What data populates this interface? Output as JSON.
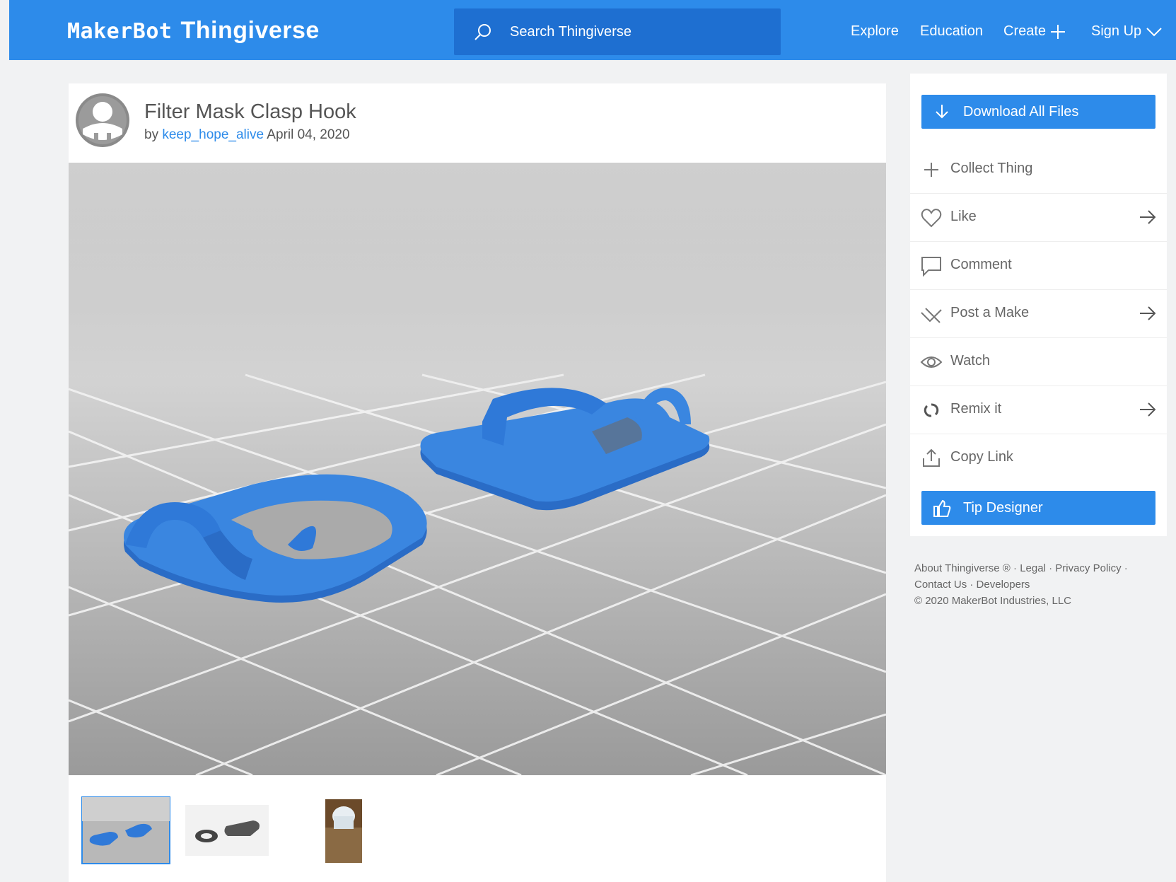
{
  "brand": {
    "logo_mark": "MakerBot",
    "logo_name": "Thingiverse"
  },
  "search": {
    "placeholder": "Search Thingiverse"
  },
  "nav": {
    "explore": "Explore",
    "education": "Education",
    "create": "Create",
    "signup": "Sign Up"
  },
  "thing": {
    "title": "Filter Mask Clasp Hook",
    "by": "by",
    "author": "keep_hope_alive",
    "date": "April 04, 2020"
  },
  "sidebar": {
    "download": "Download All Files",
    "actions": [
      {
        "label": "Collect Thing",
        "icon": "plus-icon",
        "arrow": false
      },
      {
        "label": "Like",
        "icon": "heart-icon",
        "arrow": true
      },
      {
        "label": "Comment",
        "icon": "comment-icon",
        "arrow": false
      },
      {
        "label": "Post a Make",
        "icon": "pencil-icon",
        "arrow": true
      },
      {
        "label": "Watch",
        "icon": "eye-icon",
        "arrow": false
      },
      {
        "label": "Remix it",
        "icon": "remix-icon",
        "arrow": true
      },
      {
        "label": "Copy Link",
        "icon": "share-icon",
        "arrow": false
      }
    ],
    "tip": "Tip Designer"
  },
  "footer": {
    "about": "About Thingiverse ®",
    "legal": "Legal",
    "privacy": "Privacy Policy",
    "contact": "Contact Us",
    "developers": "Developers",
    "copyright": "© 2020 MakerBot Industries, LLC"
  },
  "colors": {
    "accent": "#2d8bea",
    "search_bg": "#1e6fd1",
    "model": "#2f79d8"
  }
}
